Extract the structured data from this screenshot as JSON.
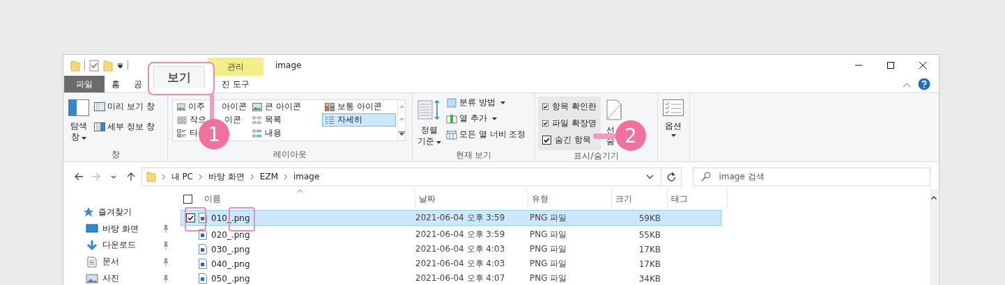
{
  "window": {
    "title": "image",
    "context_tab": "관리"
  },
  "tabs": [
    {
      "label": "파일",
      "kind": "file",
      "selected": false
    },
    {
      "label": "홈",
      "kind": "normal",
      "selected": false
    },
    {
      "label": "공",
      "kind": "normal",
      "selected": false
    },
    {
      "label": "보기",
      "kind": "normal",
      "selected": true
    },
    {
      "label": "진 도구",
      "kind": "normal",
      "selected": false
    }
  ],
  "ribbon": {
    "panes": {
      "nav_pane": [
        "탐색",
        "창"
      ],
      "items": [
        {
          "label": "미리 보기 창",
          "kind": "preview"
        },
        {
          "label": "세부 정보 창",
          "kind": "details"
        }
      ],
      "group_label": "창"
    },
    "layout": {
      "items": [
        {
          "parts": [
            "이주",
            "아이콘"
          ],
          "kind": "extra-large",
          "selected": false
        },
        {
          "parts": [
            "큰 아이콘"
          ],
          "kind": "large",
          "selected": false
        },
        {
          "parts": [
            "보통 아이콘"
          ],
          "kind": "medium",
          "selected": false
        },
        {
          "parts": [
            "작으",
            "이콘"
          ],
          "kind": "small",
          "selected": false
        },
        {
          "parts": [
            "목록"
          ],
          "kind": "list",
          "selected": false
        },
        {
          "parts": [
            "자세히"
          ],
          "kind": "details",
          "selected": true
        },
        {
          "parts": [
            "타"
          ],
          "kind": "tiles",
          "selected": false
        },
        {
          "parts": [
            "내용"
          ],
          "kind": "content",
          "selected": false
        }
      ],
      "group_label": "레이아웃"
    },
    "current_view": {
      "sort": [
        "정렬",
        "기준"
      ],
      "items": [
        {
          "label": "분류 방법",
          "kind": "group-by",
          "dropdown": true
        },
        {
          "label": "열 추가",
          "kind": "add-column",
          "dropdown": true
        },
        {
          "label": "모든 열 너비 조정",
          "kind": "fit-columns",
          "dropdown": false
        }
      ],
      "group_label": "현재 보기"
    },
    "show_hide": {
      "checks": [
        {
          "label": "항목 확인란",
          "checked": true
        },
        {
          "label": "파일 확장명",
          "checked": true
        },
        {
          "label": "숨긴 항목",
          "checked": true
        }
      ],
      "hide_selected": [
        "선",
        "숨"
      ],
      "group_label": "표시/숨기기"
    },
    "options": {
      "label": "옵션"
    }
  },
  "nav_buttons": [
    {
      "kind": "back",
      "disabled": false
    },
    {
      "kind": "forward",
      "disabled": true
    },
    {
      "kind": "recent",
      "disabled": false
    },
    {
      "kind": "up",
      "disabled": false
    }
  ],
  "address": {
    "path": [
      "내 PC",
      "바탕 화면",
      "EZM",
      "image"
    ]
  },
  "search": {
    "placeholder": "image 검색"
  },
  "sidebar": {
    "items": [
      {
        "label": "즐겨찾기",
        "kind": "quick-access",
        "pinned": false
      },
      {
        "label": "바탕 화면",
        "kind": "desktop",
        "pinned": true
      },
      {
        "label": "다운로드",
        "kind": "downloads",
        "pinned": true
      },
      {
        "label": "문서",
        "kind": "documents",
        "pinned": true
      },
      {
        "label": "사진",
        "kind": "pictures",
        "pinned": true
      }
    ]
  },
  "table": {
    "select_all_checked": false,
    "columns": [
      {
        "label": "이름",
        "sorted": true
      },
      {
        "label": "날짜",
        "sorted": false
      },
      {
        "label": "유형",
        "sorted": false
      },
      {
        "label": "크기",
        "sorted": false
      },
      {
        "label": "태그",
        "sorted": false
      }
    ],
    "rows": [
      {
        "name": "010_.png",
        "date": "2021-06-04 오후 3:59",
        "type": "PNG 파일",
        "size": "59KB",
        "selected": true,
        "checked": true
      },
      {
        "name": "020_.png",
        "date": "2021-06-04 오후 3:59",
        "type": "PNG 파일",
        "size": "55KB",
        "selected": false,
        "checked": false
      },
      {
        "name": "030_.png",
        "date": "2021-06-04 오후 4:03",
        "type": "PNG 파일",
        "size": "17KB",
        "selected": false,
        "checked": false
      },
      {
        "name": "040_.png",
        "date": "2021-06-04 오후 4:03",
        "type": "PNG 파일",
        "size": "17KB",
        "selected": false,
        "checked": false
      },
      {
        "name": "050_.png",
        "date": "2021-06-04 오후 4:07",
        "type": "PNG 파일",
        "size": "34KB",
        "selected": false,
        "checked": false
      }
    ]
  },
  "callouts": [
    {
      "number": "1"
    },
    {
      "number": "2"
    }
  ]
}
